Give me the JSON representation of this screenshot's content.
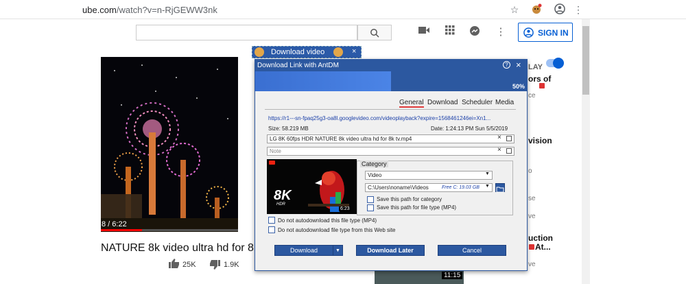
{
  "browser": {
    "url_host": "ube.com",
    "url_path": "/watch?v=n-RjGEWW3nk",
    "bookmark_icon": "star-icon",
    "extension_icon": "puzzle-icon",
    "profile_icon": "account-icon",
    "menu_icon": "kebab-menu-icon"
  },
  "youtube": {
    "signin_label": "SIGN IN",
    "search_placeholder": "",
    "autoplay_label": "LAY",
    "video_title": "NATURE 8k video ultra hd for 8k tv",
    "time": "8 / 6:22",
    "likes": "25K",
    "dislikes": "1.9K",
    "side": [
      {
        "text": "ors of",
        "meta": ""
      },
      {
        "text": "",
        "meta": "ce"
      },
      {
        "text": "vision",
        "meta": ""
      },
      {
        "text": "",
        "meta": "o"
      },
      {
        "text": "",
        "meta": "se"
      },
      {
        "text": "",
        "meta": "ve"
      },
      {
        "text": "uction",
        "meta": ""
      },
      {
        "text": "At...",
        "meta": "ve"
      }
    ],
    "side_thumb_time": "11:15"
  },
  "dv_panel": {
    "label": "Download video",
    "close": "×"
  },
  "dialog": {
    "title": "Download Link with AntDM",
    "help": "?",
    "close": "×",
    "progress_percent": 50,
    "progress_label": "50%",
    "tabs": [
      "General",
      "Download",
      "Scheduler",
      "Media"
    ],
    "active_tab": "General",
    "url": "https://r1---sn-fpaq25g3-oa8l.googlevideo.com/videoplayback?expire=1568461246ei=Xn1...",
    "size": "Size: 58.219 MB",
    "date": "Date: 1:24:13 PM Sun 5/5/2019",
    "filename": "LG 8K 60fps HDR NATURE 8k video ultra hd for 8k tv.mp4",
    "note_placeholder": "Note",
    "category_label": "Category",
    "category_value": "Video",
    "path_value": "C:\\Users\\noname\\Videos",
    "free_space": "Free C: 19.03 GB",
    "save_path_category": "Save this path for category",
    "save_path_type": "Save this path for file type (MP4)",
    "no_auto_type": "Do not autodownload this file type (MP4)",
    "no_auto_site": "Do not autodownload file type from this Web site",
    "thumb_badge": "8K",
    "thumb_badge_sub": "HDR",
    "thumb_time": "6:23",
    "download_label": "Download",
    "download_later_label": "Download Later",
    "cancel_label": "Cancel"
  }
}
